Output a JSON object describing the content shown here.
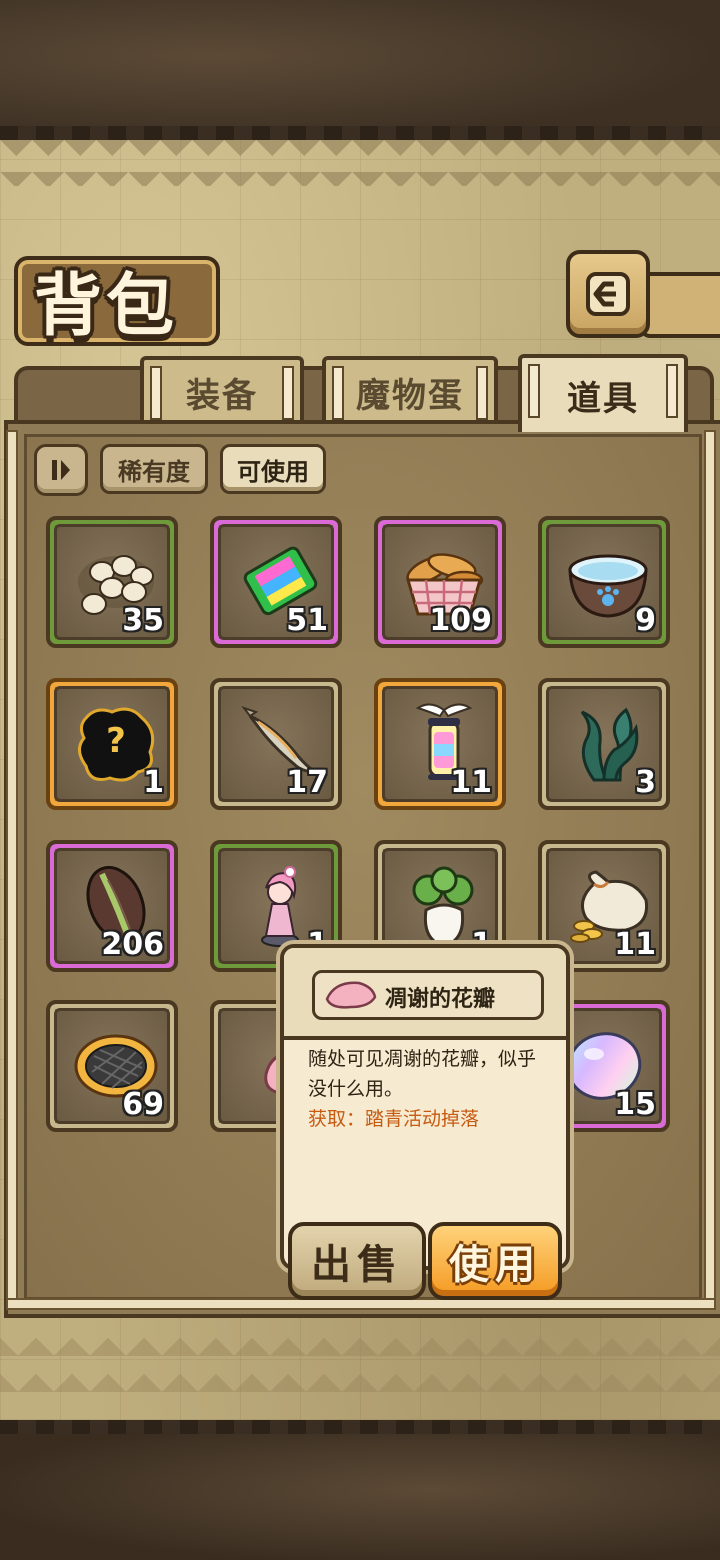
{
  "page_title": "背包",
  "tabs": [
    {
      "label": "装备",
      "active": false
    },
    {
      "label": "魔物蛋",
      "active": false
    },
    {
      "label": "道具",
      "active": true
    }
  ],
  "filters": {
    "rarity": "稀有度",
    "usable": "可使用",
    "usable_active": true
  },
  "items": [
    {
      "name": "eggs",
      "count": "35",
      "rarity": "green"
    },
    {
      "name": "rainbow-book",
      "count": "51",
      "rarity": "pink"
    },
    {
      "name": "bread-basket",
      "count": "109",
      "rarity": "pink"
    },
    {
      "name": "water-bowl",
      "count": "9",
      "rarity": "green"
    },
    {
      "name": "mystery-silhouette",
      "count": "1",
      "rarity": "gold"
    },
    {
      "name": "fish",
      "count": "17",
      "rarity": "gray"
    },
    {
      "name": "winged-lantern",
      "count": "11",
      "rarity": "gold"
    },
    {
      "name": "seaweed",
      "count": "3",
      "rarity": "gray"
    },
    {
      "name": "seed",
      "count": "206",
      "rarity": "pink"
    },
    {
      "name": "figurine",
      "count": "1",
      "rarity": "green"
    },
    {
      "name": "turnip",
      "count": "1",
      "rarity": "gray"
    },
    {
      "name": "coin-sack",
      "count": "11",
      "rarity": "gray"
    },
    {
      "name": "pie",
      "count": "69",
      "rarity": "gray"
    },
    {
      "name": "petal",
      "count": "",
      "rarity": "gray"
    },
    {
      "name": "hidden",
      "count": "",
      "rarity": "gray"
    },
    {
      "name": "rainbow-egg",
      "count": "15",
      "rarity": "pink"
    }
  ],
  "popup": {
    "item_name": "凋谢的花瓣",
    "description": "随处可见凋谢的花瓣，似乎没什么用。",
    "source": "获取：踏青活动掉落",
    "sell_label": "出售",
    "use_label": "使用"
  },
  "colors": {
    "green": "#6f9a3c",
    "pink": "#d96ad6",
    "gold": "#f2a73c",
    "gray": "#c8b88e",
    "source_text": "#c65b12"
  }
}
